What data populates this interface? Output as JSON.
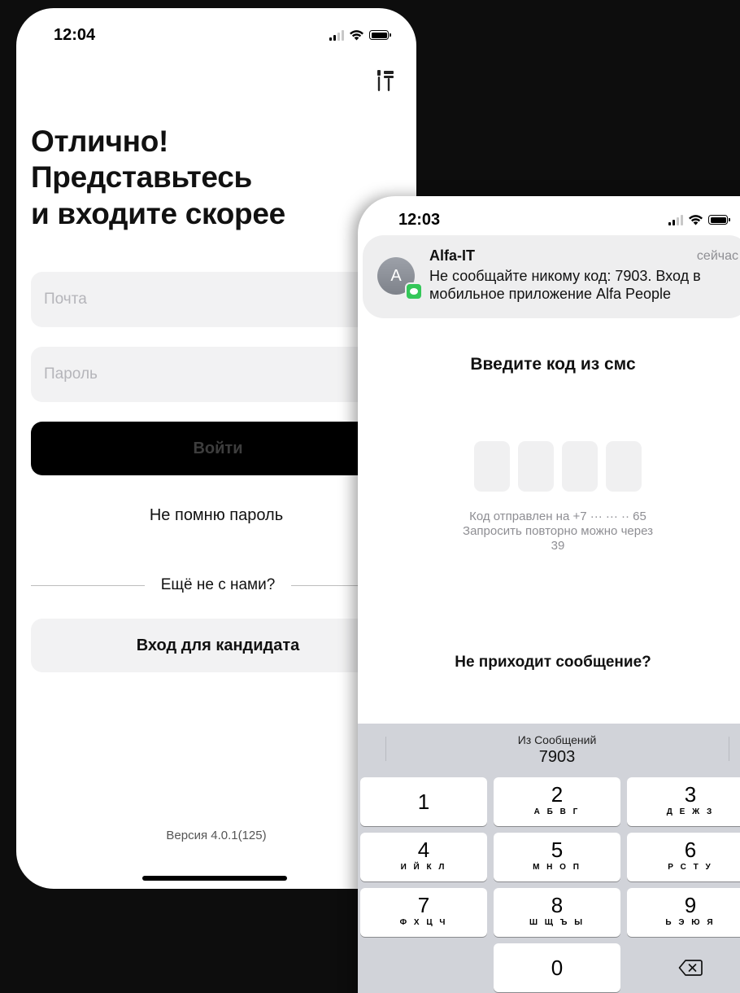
{
  "left_screen": {
    "status_time": "12:04",
    "heading": "Отлично!\nПредставьтесь\nи входите скорее",
    "email_placeholder": "Почта",
    "password_placeholder": "Пароль",
    "login_button": "Войти",
    "forgot_password": "Не помню пароль",
    "divider_text": "Ещё не с нами?",
    "candidate_button": "Вход для кандидата",
    "version": "Версия 4.0.1(125)"
  },
  "right_screen": {
    "status_time": "12:03",
    "notification": {
      "avatar_letter": "A",
      "sender": "Alfa-IT",
      "time": "сейчас",
      "text": "Не сообщайте никому код: 7903. Вход в мобильное приложение Alfa People"
    },
    "code_title": "Введите код из смс",
    "code_sent_line1": "Код отправлен на +7 ··· ··· ·· 65",
    "code_sent_line2": "Запросить повторно можно через",
    "code_sent_line3": "39",
    "no_message": "Не приходит сообщение?",
    "keyboard": {
      "suggestion_source": "Из Сообщений",
      "suggestion_value": "7903",
      "keys": [
        {
          "num": "1",
          "letters": ""
        },
        {
          "num": "2",
          "letters": "А Б В Г"
        },
        {
          "num": "3",
          "letters": "Д Е Ж З"
        },
        {
          "num": "4",
          "letters": "И Й К Л"
        },
        {
          "num": "5",
          "letters": "М Н О П"
        },
        {
          "num": "6",
          "letters": "Р С Т У"
        },
        {
          "num": "7",
          "letters": "Ф Х Ц Ч"
        },
        {
          "num": "8",
          "letters": "Ш Щ Ъ Ы"
        },
        {
          "num": "9",
          "letters": "Ь Э Ю Я"
        },
        {
          "num": "0",
          "letters": ""
        }
      ]
    }
  },
  "colors": {
    "background": "#0d0d0d",
    "primary_button": "#000000",
    "field_background": "#f2f2f3",
    "keyboard_background": "#d1d3d9",
    "message_badge": "#34c759"
  },
  "icons": [
    "signal-icon",
    "wifi-icon",
    "battery-icon",
    "tools-icon",
    "messages-icon",
    "delete-icon"
  ]
}
